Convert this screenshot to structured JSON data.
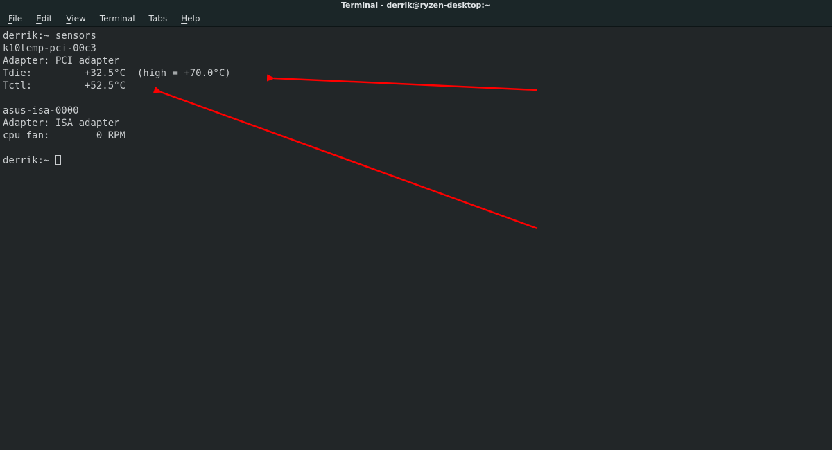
{
  "title": "Terminal - derrik@ryzen-desktop:~",
  "menu": {
    "file": "File",
    "edit": "Edit",
    "view": "View",
    "terminal": "Terminal",
    "tabs": "Tabs",
    "help": "Help"
  },
  "term": {
    "prompt1": "derrik:~",
    "command": "sensors",
    "sensor1_name": "k10temp-pci-00c3",
    "sensor1_adapter": "Adapter: PCI adapter",
    "tdie_line": "Tdie:         +32.5°C  (high = +70.0°C)",
    "tctl_line": "Tctl:         +52.5°C",
    "sensor2_name": "asus-isa-0000",
    "sensor2_adapter": "Adapter: ISA adapter",
    "cpu_fan_line": "cpu_fan:        0 RPM",
    "prompt2": "derrik:~"
  },
  "arrows": {
    "color": "#ff0000"
  }
}
